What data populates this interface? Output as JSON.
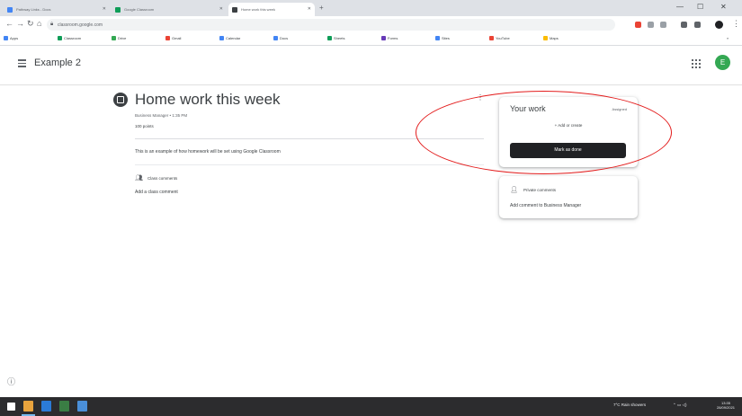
{
  "browser": {
    "tabs": [
      {
        "label": "Pathway Links - Docs"
      },
      {
        "label": "Google Classroom"
      },
      {
        "label": "Home work this week"
      }
    ],
    "url": "classroom.google.com",
    "bookmarks": [
      "Apps",
      "Classroom",
      "Drive",
      "Gmail",
      "Calendar",
      "Docs",
      "Sheets",
      "Forms",
      "Sites",
      "YouTube",
      "Maps"
    ]
  },
  "app": {
    "class_name": "Example 2",
    "avatar_initial": "E"
  },
  "assignment": {
    "title": "Home work this week",
    "meta": "Business Manager • 1:35 PM",
    "points": "100 points",
    "description": "This is an example of how homework will be set using Google Classroom",
    "class_comments_label": "Class comments",
    "add_class_comment": "Add a class comment"
  },
  "your_work": {
    "title": "Your work",
    "status": "Assigned",
    "add_label": "+ Add or create",
    "done_button": "Mark as done"
  },
  "private_comments": {
    "label": "Private comments",
    "add": "Add comment to Business Manager"
  },
  "taskbar": {
    "tray_text": "7°C  Rain showers",
    "time": "13:35",
    "date": "28/09/2021"
  },
  "colors": {
    "accent_green": "#34a853",
    "annotation_red": "#e31c1c",
    "done_button": "#202124"
  }
}
